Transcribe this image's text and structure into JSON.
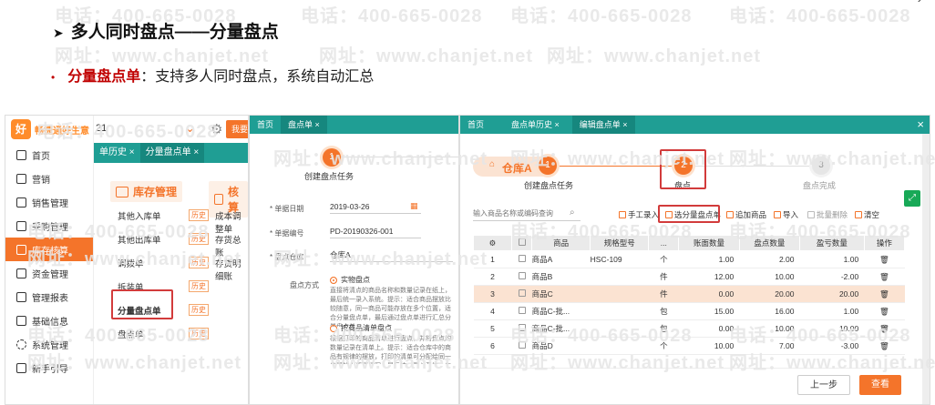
{
  "slide": {
    "corner_mark": "›",
    "title": "多人同时盘点——分量盘点",
    "bullet_term": "分量盘点单",
    "bullet_text": "：支持多人同时盘点，系统自动汇总"
  },
  "watermark": {
    "phone": "电话：400-665-0028",
    "site": "网址：www.chanjet.net"
  },
  "panel1": {
    "logo_text": "畅捷通好生意",
    "logo_badge": "好",
    "top_number": "21",
    "top_button": "我要",
    "tabs": [
      "单历史 ×",
      "分量盘点单 ×"
    ],
    "nav": [
      {
        "label": "首页",
        "active": false
      },
      {
        "label": "营销",
        "active": false
      },
      {
        "label": "销售管理",
        "active": false
      },
      {
        "label": "采购管理",
        "active": false
      },
      {
        "label": "库存核算",
        "active": true
      },
      {
        "label": "资金管理",
        "active": false
      },
      {
        "label": "管理报表",
        "active": false
      },
      {
        "label": "基础信息",
        "active": false
      },
      {
        "label": "系统管理",
        "active": false
      },
      {
        "label": "新手引导",
        "active": false
      }
    ],
    "section_inventory": "库存管理",
    "section_cost": "核算",
    "menu_left": [
      "其他入库单",
      "其他出库单",
      "调拨单",
      "拆装单",
      "分量盘点单",
      "盘点单"
    ],
    "menu_right": [
      "成本调整单",
      "存货总账",
      "存货明细账"
    ],
    "history_label": "历史"
  },
  "panel2": {
    "tabs": [
      "首页",
      "盘点单 ×"
    ],
    "step_num": "1",
    "step_label": "创建盘点任务",
    "fields": [
      {
        "label": "* 单据日期",
        "value": "2019-03-26"
      },
      {
        "label": "* 单据编号",
        "value": "PD-20190326-001"
      },
      {
        "label": "* 盘点仓库",
        "value": "仓库A"
      }
    ],
    "method_label": "盘点方式",
    "method_opt1": "实物盘点",
    "method_note1": "直接将清点的商品名称和数量记录在纸上，最后统一录入系统。提示：适合商品摆放比较随意，同一商品可能存放在多个位置，适合分量盘点单，最后通过盘点单进行汇总分量盘点单。",
    "method_opt2": "按商品清单盘点",
    "method_note2": "根据打印的商品清单进行盘点，并将盘点的数量记录在清单上。提示：适合仓库中的商品有规律的摆放，打印的清单可分配给同一位置的人逐项填写，最后统一录入系统，每一位置最先盘点清单到某一商品。"
  },
  "panel3": {
    "tabs": [
      "首页",
      "盘点单历史 ×",
      "编辑盘点单 ×"
    ],
    "warehouse": "仓库A",
    "steps": [
      {
        "num": "1",
        "label": "创建盘点任务"
      },
      {
        "num": "2",
        "label": "盘点"
      },
      {
        "num": "3",
        "label": "盘点完成"
      }
    ],
    "search_placeholder": "输入商品名称或编码查询",
    "toolbar": [
      "手工录入",
      "选分量盘点单",
      "追加商品",
      "导入",
      "批量删除",
      "清空"
    ],
    "columns": [
      "",
      "",
      "商品",
      "规格型号",
      "...",
      "账面数量",
      "盘点数量",
      "盈亏数量",
      "操作"
    ],
    "rows": [
      {
        "no": "1",
        "name": "商品A",
        "spec": "HSC-109",
        "unit": "个",
        "book": "1.00",
        "count": "2.00",
        "diff": "1.00"
      },
      {
        "no": "2",
        "name": "商品B",
        "spec": "",
        "unit": "件",
        "book": "12.00",
        "count": "10.00",
        "diff": "-2.00"
      },
      {
        "no": "3",
        "name": "商品C",
        "spec": "",
        "unit": "件",
        "book": "0.00",
        "count": "20.00",
        "diff": "20.00"
      },
      {
        "no": "4",
        "name": "商品C-批...",
        "spec": "",
        "unit": "包",
        "book": "15.00",
        "count": "16.00",
        "diff": "1.00"
      },
      {
        "no": "5",
        "name": "商品C-批...",
        "spec": "",
        "unit": "包",
        "book": "0.00",
        "count": "10.00",
        "diff": "10.00"
      },
      {
        "no": "6",
        "name": "商品D",
        "spec": "",
        "unit": "个",
        "book": "10.00",
        "count": "7.00",
        "diff": "-3.00"
      }
    ],
    "prev_button": "上一步",
    "view_button": "查看"
  },
  "colors": {
    "accent": "#f4742a",
    "teal": "#1f9e94",
    "highlight": "#d23b3b",
    "title_red": "#c00000"
  }
}
